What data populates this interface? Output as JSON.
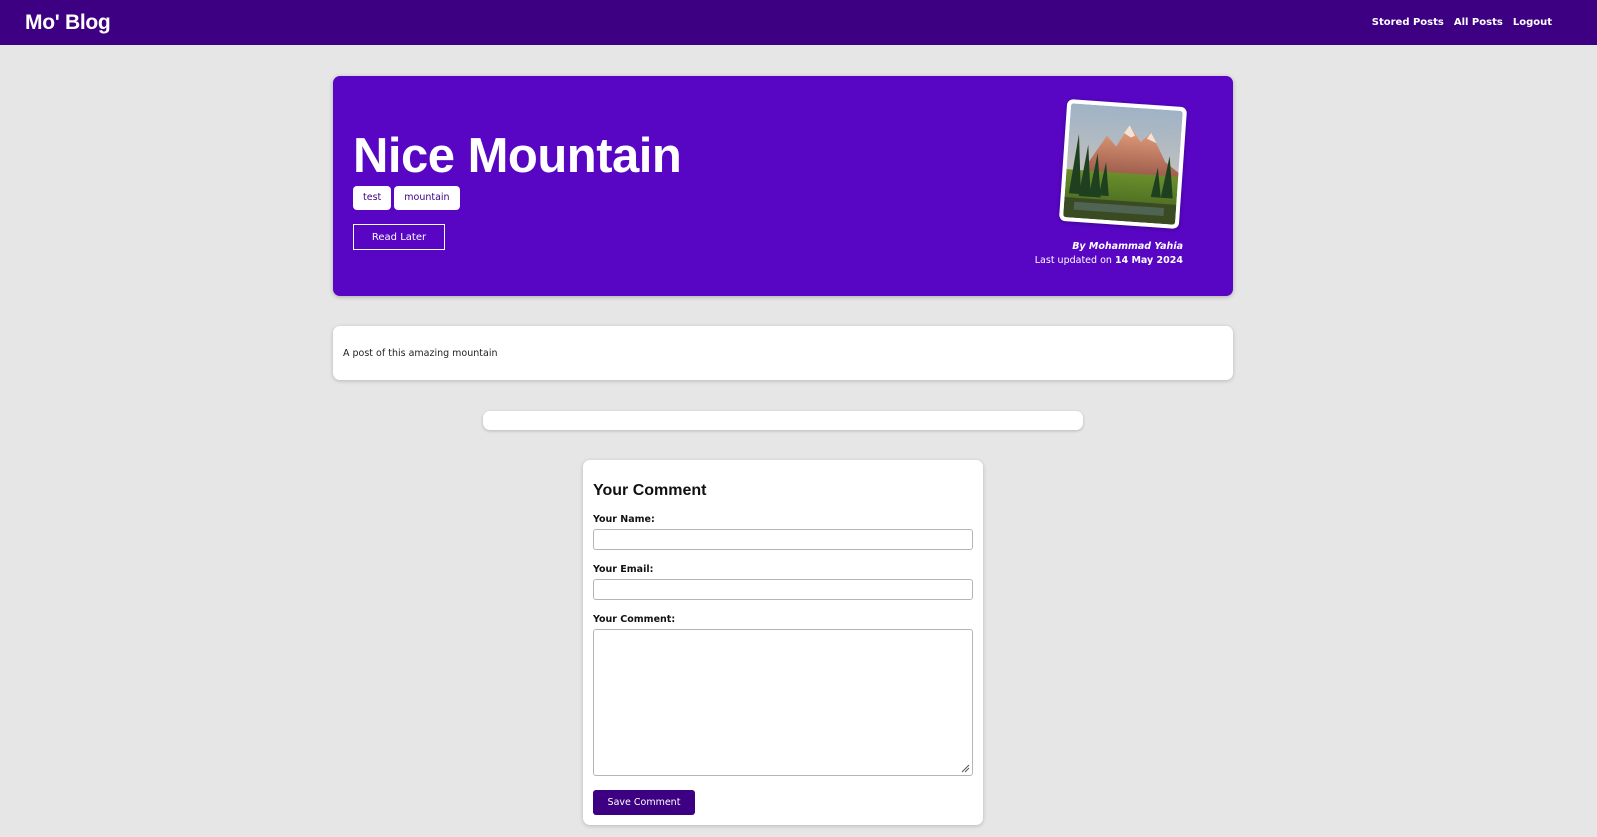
{
  "header": {
    "logo": "Mo' Blog",
    "nav": [
      {
        "label": "Stored Posts"
      },
      {
        "label": "All Posts"
      },
      {
        "label": "Logout"
      }
    ]
  },
  "post": {
    "title": "Nice Mountain",
    "tags": [
      "test",
      "mountain"
    ],
    "read_later_label": "Read Later",
    "author": "By Mohammad Yahia",
    "updated_prefix": "Last updated on",
    "updated_date": "14 May 2024",
    "image_alt": "mountain-photo",
    "content": "A post of this amazing mountain"
  },
  "comment_form": {
    "title": "Your Comment",
    "name_label": "Your Name:",
    "name_value": "",
    "email_label": "Your Email:",
    "email_value": "",
    "comment_label": "Your Comment:",
    "comment_value": "",
    "save_label": "Save Comment"
  },
  "colors": {
    "header_bg": "#3d0083",
    "hero_bg": "#5806c4",
    "page_bg": "#e6e6e6",
    "button_bg": "#3d0083"
  }
}
